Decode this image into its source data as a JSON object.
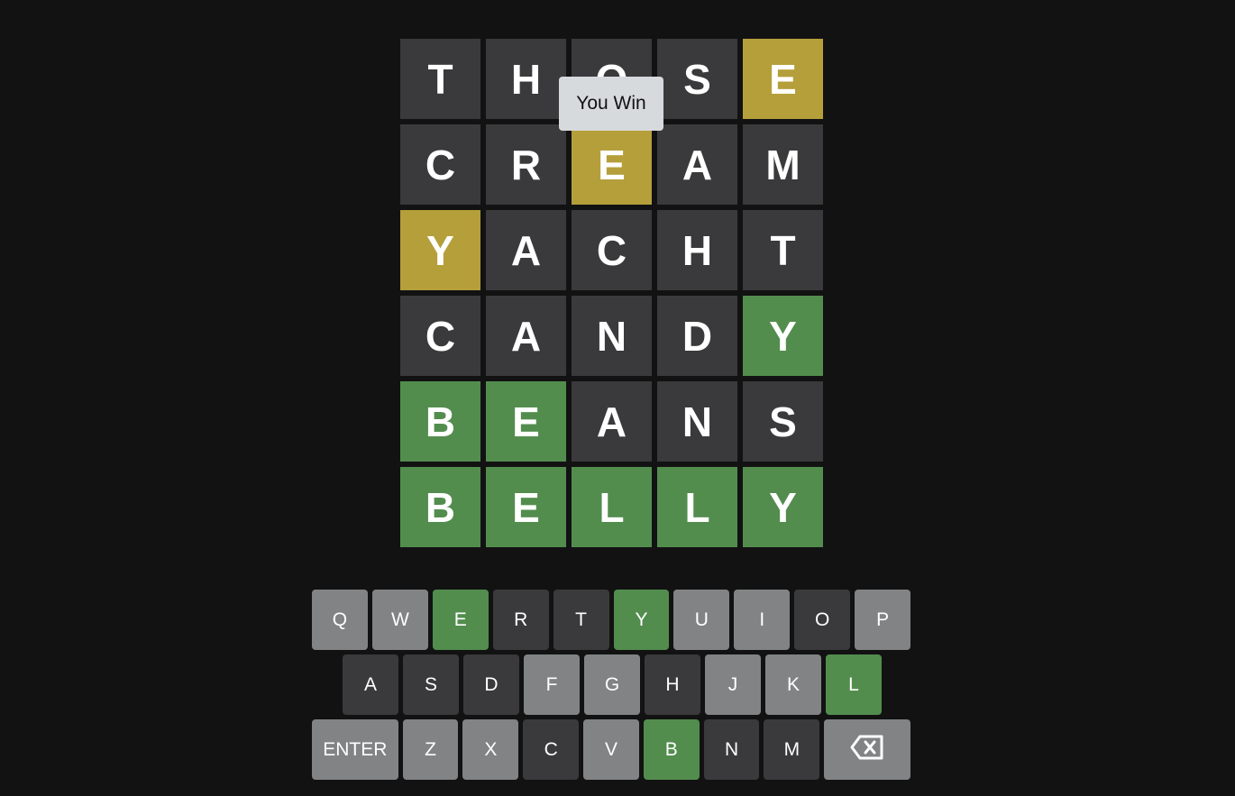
{
  "board": {
    "rows": [
      {
        "tiles": [
          {
            "letter": "T",
            "state": "absent"
          },
          {
            "letter": "H",
            "state": "absent"
          },
          {
            "letter": "O",
            "state": "absent"
          },
          {
            "letter": "S",
            "state": "absent"
          },
          {
            "letter": "E",
            "state": "present"
          }
        ]
      },
      {
        "tiles": [
          {
            "letter": "C",
            "state": "absent"
          },
          {
            "letter": "R",
            "state": "absent"
          },
          {
            "letter": "E",
            "state": "present"
          },
          {
            "letter": "A",
            "state": "absent"
          },
          {
            "letter": "M",
            "state": "absent"
          }
        ]
      },
      {
        "tiles": [
          {
            "letter": "Y",
            "state": "present"
          },
          {
            "letter": "A",
            "state": "absent"
          },
          {
            "letter": "C",
            "state": "absent"
          },
          {
            "letter": "H",
            "state": "absent"
          },
          {
            "letter": "T",
            "state": "absent"
          }
        ]
      },
      {
        "tiles": [
          {
            "letter": "C",
            "state": "absent"
          },
          {
            "letter": "A",
            "state": "absent"
          },
          {
            "letter": "N",
            "state": "absent"
          },
          {
            "letter": "D",
            "state": "absent"
          },
          {
            "letter": "Y",
            "state": "correct"
          }
        ]
      },
      {
        "tiles": [
          {
            "letter": "B",
            "state": "correct"
          },
          {
            "letter": "E",
            "state": "correct"
          },
          {
            "letter": "A",
            "state": "absent"
          },
          {
            "letter": "N",
            "state": "absent"
          },
          {
            "letter": "S",
            "state": "absent"
          }
        ]
      },
      {
        "tiles": [
          {
            "letter": "B",
            "state": "correct"
          },
          {
            "letter": "E",
            "state": "correct"
          },
          {
            "letter": "L",
            "state": "correct"
          },
          {
            "letter": "L",
            "state": "correct"
          },
          {
            "letter": "Y",
            "state": "correct"
          }
        ]
      }
    ]
  },
  "toast": {
    "message": "You Win"
  },
  "keyboard": {
    "rows": [
      [
        {
          "label": "Q",
          "state": "unused"
        },
        {
          "label": "W",
          "state": "unused"
        },
        {
          "label": "E",
          "state": "correct"
        },
        {
          "label": "R",
          "state": "absent"
        },
        {
          "label": "T",
          "state": "absent"
        },
        {
          "label": "Y",
          "state": "correct"
        },
        {
          "label": "U",
          "state": "unused"
        },
        {
          "label": "I",
          "state": "unused"
        },
        {
          "label": "O",
          "state": "absent"
        },
        {
          "label": "P",
          "state": "unused"
        }
      ],
      [
        {
          "label": "A",
          "state": "absent"
        },
        {
          "label": "S",
          "state": "absent"
        },
        {
          "label": "D",
          "state": "absent"
        },
        {
          "label": "F",
          "state": "unused"
        },
        {
          "label": "G",
          "state": "unused"
        },
        {
          "label": "H",
          "state": "absent"
        },
        {
          "label": "J",
          "state": "unused"
        },
        {
          "label": "K",
          "state": "unused"
        },
        {
          "label": "L",
          "state": "correct"
        }
      ],
      [
        {
          "label": "ENTER",
          "state": "unused",
          "wide": true,
          "name": "enter-key"
        },
        {
          "label": "Z",
          "state": "unused"
        },
        {
          "label": "X",
          "state": "unused"
        },
        {
          "label": "C",
          "state": "absent"
        },
        {
          "label": "V",
          "state": "unused"
        },
        {
          "label": "B",
          "state": "correct"
        },
        {
          "label": "N",
          "state": "absent"
        },
        {
          "label": "M",
          "state": "absent"
        },
        {
          "label": "",
          "icon": "backspace-icon",
          "state": "unused",
          "wide": true,
          "name": "backspace-key"
        }
      ]
    ]
  },
  "colors": {
    "background": "#121213",
    "absent": "#3a3a3c",
    "present": "#b59f3b",
    "correct": "#538d4e",
    "unused_key": "#818384",
    "toast_bg": "#d7dadc"
  }
}
